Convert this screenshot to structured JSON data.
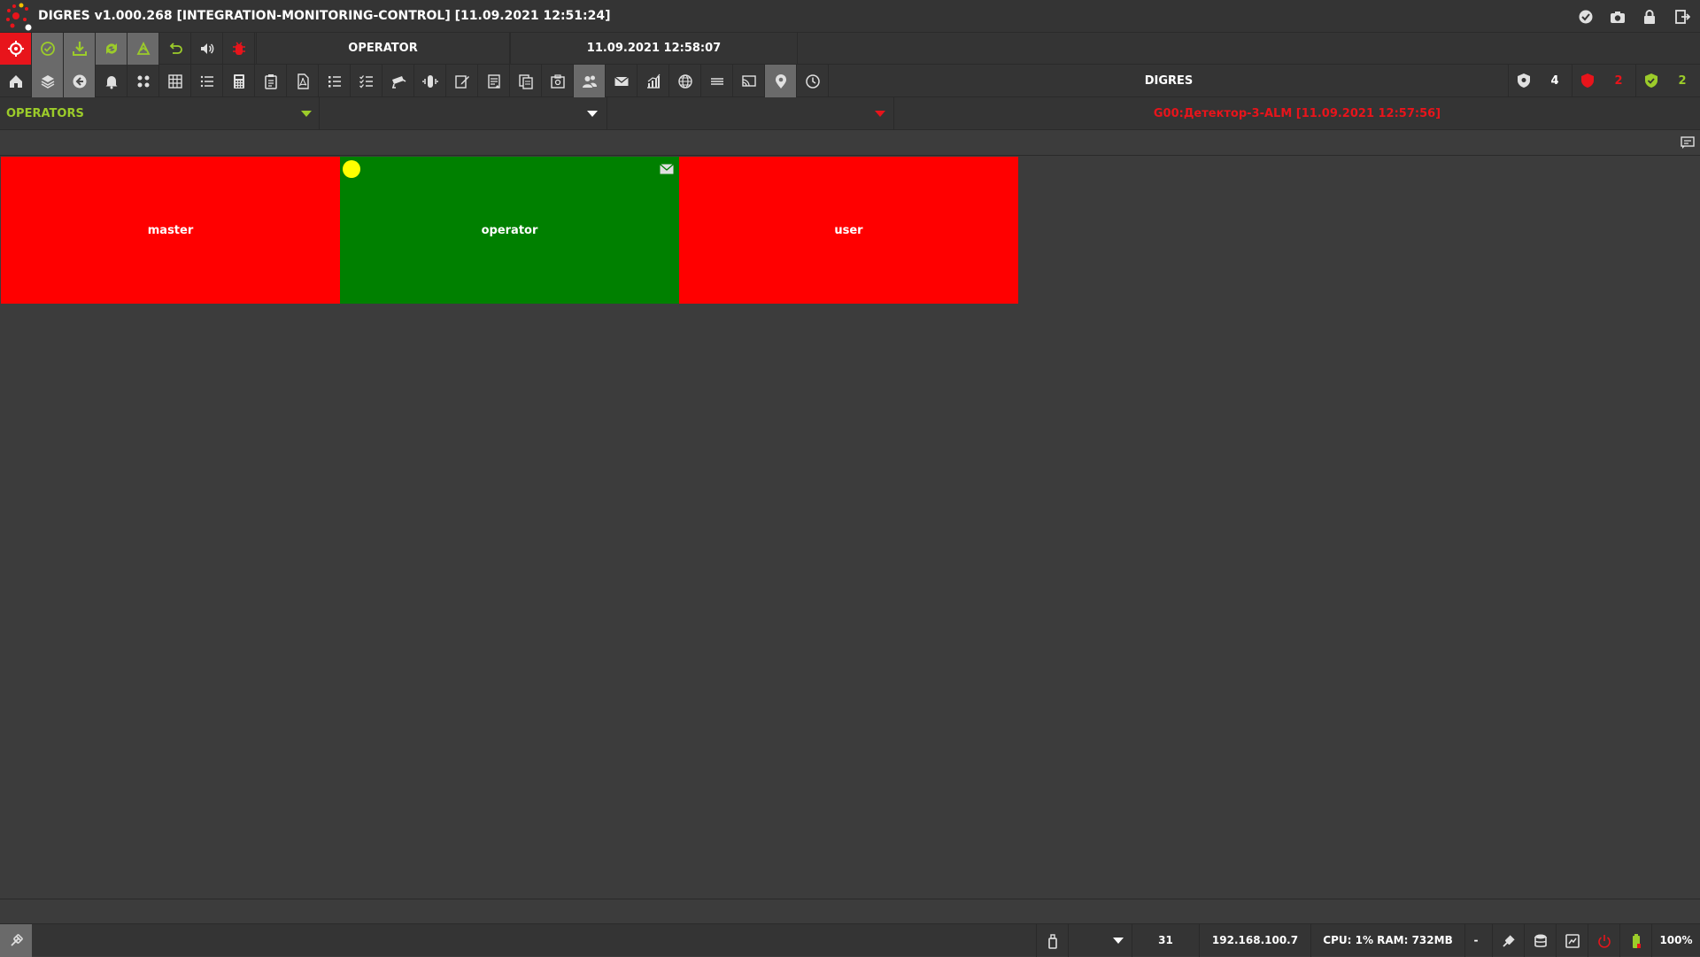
{
  "window": {
    "title": "DIGRES v1.000.268 [INTEGRATION-MONITORING-CONTROL] [11.09.2021 12:51:24]"
  },
  "titlebar_icons": [
    "check-circle-icon",
    "camera-icon",
    "lock-icon",
    "logout-icon"
  ],
  "toolbar1": {
    "buttons": [
      "target-icon",
      "check-circle-icon",
      "download-icon",
      "sync-icon",
      "recycle-icon",
      "undo-icon",
      "speaker-icon",
      "bug-icon"
    ],
    "user_label": "OPERATOR",
    "datetime": "11.09.2021 12:58:07"
  },
  "toolbar2": {
    "buttons": [
      "home-icon",
      "layers-icon",
      "back-icon",
      "bell-icon",
      "grid-dots-icon",
      "table-icon",
      "list-icon",
      "calculator-icon",
      "clipboard-icon",
      "pdf-icon",
      "bullet-list-icon",
      "checklist-icon",
      "camera-cctv-icon",
      "audio-icon",
      "edit-icon",
      "document-icon",
      "copy-icon",
      "screenshot-icon",
      "users-icon",
      "mail-icon",
      "chart-icon",
      "globe-icon",
      "lines-icon",
      "cast-icon",
      "map-pin-icon",
      "clock-icon"
    ],
    "system_name": "DIGRES",
    "counters": [
      {
        "icon": "shield-icon",
        "value": "4",
        "color": "#ffffff"
      },
      {
        "icon": "shield-alert-icon",
        "value": "2",
        "color": "#e8141b"
      },
      {
        "icon": "shield-ok-icon",
        "value": "2",
        "color": "#9ccc2a"
      }
    ]
  },
  "filters": {
    "group": "OPERATORS",
    "second": "",
    "third": "",
    "alarm": "G00:Детектор-3-ALM [11.09.2021 12:57:56]"
  },
  "tiles": [
    {
      "name": "master",
      "color": "#ff0000",
      "has_dot": false,
      "has_mail": false
    },
    {
      "name": "operator",
      "color": "#008000",
      "has_dot": true,
      "has_mail": true
    },
    {
      "name": "user",
      "color": "#ff0000",
      "has_dot": false,
      "has_mail": false
    }
  ],
  "statusbar": {
    "count": "31",
    "ip": "192.168.100.7",
    "resources": "CPU: 1% RAM: 732MB",
    "dash": "-",
    "zoom": "100%"
  },
  "colors": {
    "accent_green": "#9ccc2a",
    "alarm_red": "#e8141b",
    "background": "#3c3c3c",
    "panel": "#343434"
  }
}
